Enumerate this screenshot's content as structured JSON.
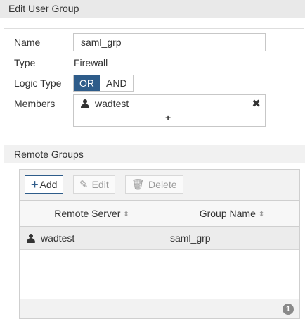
{
  "dialog": {
    "title": "Edit User Group"
  },
  "form": {
    "name_label": "Name",
    "name_value": "saml_grp",
    "type_label": "Type",
    "type_value": "Firewall",
    "logic_label": "Logic Type",
    "logic_options": [
      "OR",
      "AND"
    ],
    "logic_selected": "OR",
    "members_label": "Members",
    "members": [
      {
        "name": "wadtest",
        "icon": "user-icon"
      }
    ],
    "members_add_glyph": "+",
    "members_remove_glyph": "✖"
  },
  "remote_groups": {
    "section_title": "Remote Groups",
    "toolbar": {
      "add_label": "Add",
      "edit_label": "Edit",
      "delete_label": "Delete",
      "add_icon": "plus-icon",
      "edit_icon": "pencil-icon",
      "delete_icon": "trash-icon"
    },
    "columns": [
      "Remote Server",
      "Group Name"
    ],
    "rows": [
      {
        "remote_server": "wadtest",
        "group_name": "saml_grp"
      }
    ],
    "count": "1"
  },
  "colors": {
    "accent": "#2e5c8a",
    "header_bg": "#e9e9e9",
    "row_bg": "#ececec"
  }
}
